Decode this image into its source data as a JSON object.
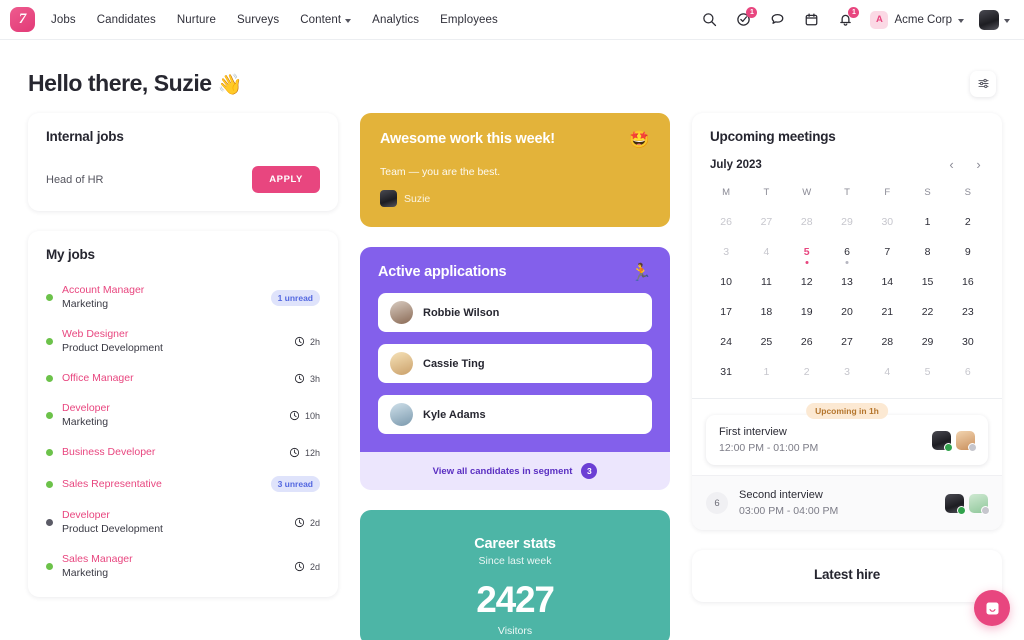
{
  "nav": {
    "logo_text": "7",
    "links": [
      {
        "label": "Jobs",
        "dropdown": false
      },
      {
        "label": "Candidates",
        "dropdown": false
      },
      {
        "label": "Nurture",
        "dropdown": false
      },
      {
        "label": "Surveys",
        "dropdown": false
      },
      {
        "label": "Content",
        "dropdown": true
      },
      {
        "label": "Analytics",
        "dropdown": false
      },
      {
        "label": "Employees",
        "dropdown": false
      }
    ],
    "icons": [
      {
        "name": "search-icon",
        "badge": null
      },
      {
        "name": "tasks-check-icon",
        "badge": "1"
      },
      {
        "name": "messages-icon",
        "badge": null
      },
      {
        "name": "calendar-icon",
        "badge": null
      },
      {
        "name": "notifications-bell-icon",
        "badge": "1"
      }
    ],
    "org": {
      "initial": "A",
      "name": "Acme Corp"
    }
  },
  "header": {
    "greeting": "Hello there, Suzie",
    "wave_emoji": "👋"
  },
  "internal_jobs": {
    "title": "Internal jobs",
    "job": "Head of HR",
    "apply_label": "APPLY"
  },
  "my_jobs": {
    "title": "My jobs",
    "items": [
      {
        "name": "Account Manager",
        "dept": "Marketing",
        "status": "green",
        "badge": "1 unread",
        "time": null
      },
      {
        "name": "Web Designer",
        "dept": "Product Development",
        "status": "green",
        "badge": null,
        "time": "2h"
      },
      {
        "name": "Office Manager",
        "dept": "",
        "status": "green",
        "badge": null,
        "time": "3h"
      },
      {
        "name": "Developer",
        "dept": "Marketing",
        "status": "green",
        "badge": null,
        "time": "10h"
      },
      {
        "name": "Business Developer",
        "dept": "",
        "status": "green",
        "badge": null,
        "time": "12h"
      },
      {
        "name": "Sales Representative",
        "dept": "",
        "status": "green",
        "badge": "3 unread",
        "time": null
      },
      {
        "name": "Developer",
        "dept": "Product Development",
        "status": "grey",
        "badge": null,
        "time": "2d"
      },
      {
        "name": "Sales Manager",
        "dept": "Marketing",
        "status": "green",
        "badge": null,
        "time": "2d"
      }
    ]
  },
  "praise": {
    "title": "Awesome work this week!",
    "emoji": "🤩",
    "body": "Team — you are the best.",
    "author": "Suzie",
    "bg": "#e3b33a"
  },
  "active_applications": {
    "title": "Active applications",
    "emoji": "🏃",
    "bg": "#8360eb",
    "candidates": [
      {
        "name": "Robbie Wilson"
      },
      {
        "name": "Cassie Ting"
      },
      {
        "name": "Kyle Adams"
      }
    ],
    "footer_label": "View all candidates in segment",
    "footer_count": "3"
  },
  "career_stats": {
    "title": "Career stats",
    "subtitle": "Since last week",
    "value": "2427",
    "label": "Visitors",
    "bg": "#4db5a6"
  },
  "meetings": {
    "title": "Upcoming meetings",
    "month": "July 2023",
    "prev_label": "‹",
    "next_label": "›",
    "day_headers": [
      "M",
      "T",
      "W",
      "T",
      "F",
      "S",
      "S"
    ],
    "days": [
      {
        "n": "26",
        "muted": true
      },
      {
        "n": "27",
        "muted": true
      },
      {
        "n": "28",
        "muted": true
      },
      {
        "n": "29",
        "muted": true
      },
      {
        "n": "30",
        "muted": true
      },
      {
        "n": "1",
        "muted": false
      },
      {
        "n": "2",
        "muted": false
      },
      {
        "n": "3",
        "muted": true
      },
      {
        "n": "4",
        "muted": true
      },
      {
        "n": "5",
        "muted": false,
        "today": true,
        "event": true
      },
      {
        "n": "6",
        "muted": false,
        "event": true
      },
      {
        "n": "7",
        "muted": false
      },
      {
        "n": "8",
        "muted": false
      },
      {
        "n": "9",
        "muted": false
      },
      {
        "n": "10",
        "muted": false
      },
      {
        "n": "11",
        "muted": false
      },
      {
        "n": "12",
        "muted": false
      },
      {
        "n": "13",
        "muted": false
      },
      {
        "n": "14",
        "muted": false
      },
      {
        "n": "15",
        "muted": false
      },
      {
        "n": "16",
        "muted": false
      },
      {
        "n": "17",
        "muted": false
      },
      {
        "n": "18",
        "muted": false
      },
      {
        "n": "19",
        "muted": false
      },
      {
        "n": "20",
        "muted": false
      },
      {
        "n": "21",
        "muted": false
      },
      {
        "n": "22",
        "muted": false
      },
      {
        "n": "23",
        "muted": false
      },
      {
        "n": "24",
        "muted": false
      },
      {
        "n": "25",
        "muted": false
      },
      {
        "n": "26",
        "muted": false
      },
      {
        "n": "27",
        "muted": false
      },
      {
        "n": "28",
        "muted": false
      },
      {
        "n": "29",
        "muted": false
      },
      {
        "n": "30",
        "muted": false
      },
      {
        "n": "31",
        "muted": false
      },
      {
        "n": "1",
        "muted": true
      },
      {
        "n": "2",
        "muted": true
      },
      {
        "n": "3",
        "muted": true
      },
      {
        "n": "4",
        "muted": true
      },
      {
        "n": "5",
        "muted": true
      },
      {
        "n": "6",
        "muted": true
      }
    ],
    "upcoming_pill": "Upcoming in 1h",
    "events": [
      {
        "day": null,
        "name": "First interview",
        "time": "12:00 PM - 01:00 PM",
        "highlight": true
      },
      {
        "day": "6",
        "name": "Second interview",
        "time": "03:00 PM - 04:00 PM",
        "highlight": false
      }
    ]
  },
  "latest_hire": {
    "title": "Latest hire"
  },
  "fab": {
    "name": "chat-launcher"
  },
  "colors": {
    "accent_pink": "#e8467f",
    "purple": "#8360eb",
    "yellow": "#e3b33a",
    "teal": "#4db5a6",
    "green_dot": "#6cc24a"
  }
}
